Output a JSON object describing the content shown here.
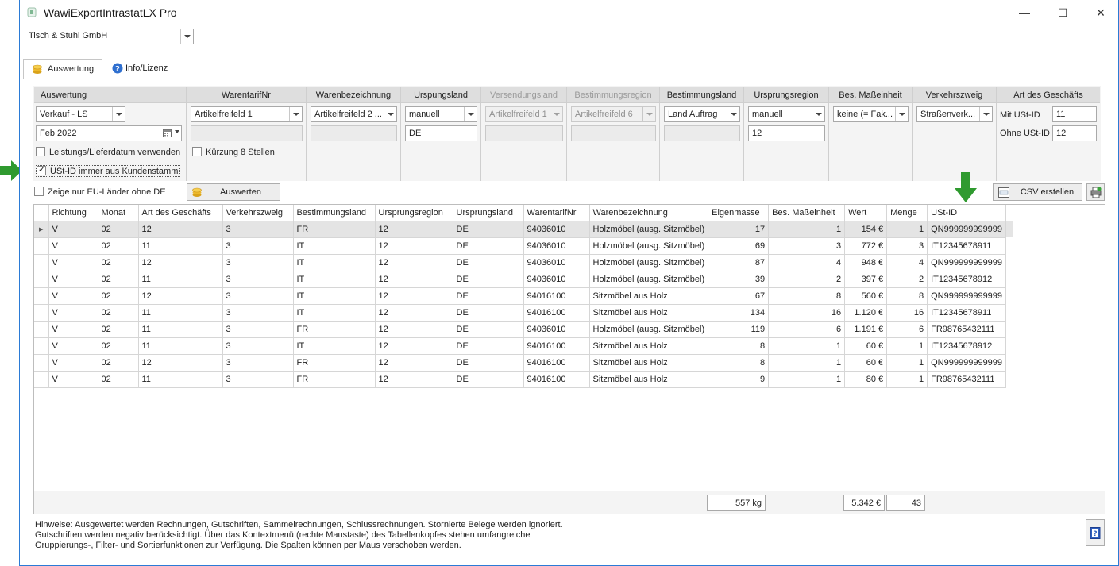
{
  "window": {
    "title": "WawiExportIntrastatLX Pro",
    "minimize": "—",
    "maximize": "☐",
    "close": "✕"
  },
  "company": {
    "value": "Tisch & Stuhl GmbH"
  },
  "tabs": [
    {
      "label": "Auswertung",
      "active": true,
      "icon": "coins-icon"
    },
    {
      "label": "Info/Lizenz",
      "active": false,
      "icon": "info-icon"
    }
  ],
  "filters": {
    "auswertung": {
      "header": "Auswertung",
      "type_value": "Verkauf - LS",
      "date_value": "Feb 2022",
      "chk_leistungsdatum": "Leistungs/Lieferdatum verwenden",
      "chk_ustid": "USt-ID immer aus Kundenstamm",
      "chk_ustid_checked": true
    },
    "warentarifnr": {
      "header": "WarentarifNr",
      "value": "Artikelfreifeld 1",
      "chk_kuerzung": "Kürzung 8 Stellen"
    },
    "warenbezeichnung": {
      "header": "Warenbezeichnung",
      "value": "Artikelfreifeld 2 ..."
    },
    "ursprungsland": {
      "header": "Urspungsland",
      "value": "manuell",
      "text": "DE"
    },
    "versendungsland": {
      "header": "Versendungsland",
      "value": "Artikelfreifeld 1"
    },
    "bestimmungsregion": {
      "header": "Bestimmungsregion",
      "value": "Artikelfreifeld 6"
    },
    "bestimmungsland": {
      "header": "Bestimmungsland",
      "value": "Land Auftrag"
    },
    "ursprungsregion": {
      "header": "Ursprungsregion",
      "value": "manuell",
      "text": "12"
    },
    "bes_masseinheit": {
      "header": "Bes. Maßeinheit",
      "value": "keine (= Fak..."
    },
    "verkehrszweig": {
      "header": "Verkehrszweig",
      "value": "Straßenverk..."
    },
    "art_geschaefts": {
      "header": "Art des Geschäfts",
      "mit_label": "Mit USt-ID",
      "mit_value": "11",
      "ohne_label": "Ohne USt-ID",
      "ohne_value": "12"
    }
  },
  "actions": {
    "chk_eu_only": "Zeige nur EU-Länder ohne DE",
    "auswerten": "Auswerten",
    "csv": "CSV erstellen"
  },
  "table": {
    "columns": [
      "Richtung",
      "Monat",
      "Art des Geschäfts",
      "Verkehrszweig",
      "Bestimmungsland",
      "Ursprungsregion",
      "Ursprungsland",
      "WarentarifNr",
      "Warenbezeichnung",
      "Eigenmasse",
      "Bes. Maßeinheit",
      "Wert",
      "Menge",
      "USt-ID"
    ],
    "rows": [
      [
        "V",
        "02",
        "12",
        "3",
        "FR",
        "12",
        "DE",
        "94036010",
        "Holzmöbel (ausg. Sitzmöbel)",
        "17",
        "1",
        "154 €",
        "1",
        "QN999999999999"
      ],
      [
        "V",
        "02",
        "11",
        "3",
        "IT",
        "12",
        "DE",
        "94036010",
        "Holzmöbel (ausg. Sitzmöbel)",
        "69",
        "3",
        "772 €",
        "3",
        "IT12345678911"
      ],
      [
        "V",
        "02",
        "12",
        "3",
        "IT",
        "12",
        "DE",
        "94036010",
        "Holzmöbel (ausg. Sitzmöbel)",
        "87",
        "4",
        "948 €",
        "4",
        "QN999999999999"
      ],
      [
        "V",
        "02",
        "11",
        "3",
        "IT",
        "12",
        "DE",
        "94036010",
        "Holzmöbel (ausg. Sitzmöbel)",
        "39",
        "2",
        "397 €",
        "2",
        "IT12345678912"
      ],
      [
        "V",
        "02",
        "12",
        "3",
        "IT",
        "12",
        "DE",
        "94016100",
        "Sitzmöbel aus Holz",
        "67",
        "8",
        "560 €",
        "8",
        "QN999999999999"
      ],
      [
        "V",
        "02",
        "11",
        "3",
        "IT",
        "12",
        "DE",
        "94016100",
        "Sitzmöbel aus Holz",
        "134",
        "16",
        "1.120 €",
        "16",
        "IT12345678911"
      ],
      [
        "V",
        "02",
        "11",
        "3",
        "FR",
        "12",
        "DE",
        "94036010",
        "Holzmöbel (ausg. Sitzmöbel)",
        "119",
        "6",
        "1.191 €",
        "6",
        "FR98765432111"
      ],
      [
        "V",
        "02",
        "11",
        "3",
        "IT",
        "12",
        "DE",
        "94016100",
        "Sitzmöbel aus Holz",
        "8",
        "1",
        "60 €",
        "1",
        "IT12345678912"
      ],
      [
        "V",
        "02",
        "12",
        "3",
        "FR",
        "12",
        "DE",
        "94016100",
        "Sitzmöbel aus Holz",
        "8",
        "1",
        "60 €",
        "1",
        "QN999999999999"
      ],
      [
        "V",
        "02",
        "11",
        "3",
        "FR",
        "12",
        "DE",
        "94016100",
        "Sitzmöbel aus Holz",
        "9",
        "1",
        "80 €",
        "1",
        "FR98765432111"
      ]
    ]
  },
  "totals": {
    "eigenmasse": "557 kg",
    "wert": "5.342 €",
    "menge": "43"
  },
  "hint": {
    "line1": "Hinweise: Ausgewertet werden Rechnungen, Gutschriften, Sammelrechnungen, Schlussrechnungen. Stornierte Belege werden ignoriert.",
    "line2": "Gutschriften werden negativ berücksichtigt. Über das Kontextmenü (rechte Maustaste) des Tabellenkopfes stehen umfangreiche",
    "line3": "Gruppierungs-, Filter- und Sortierfunktionen zur Verfügung. Die Spalten können per Maus verschoben werden."
  },
  "colors": {
    "accent_arrow": "#2f9a2f",
    "window_border": "#2b7bd6",
    "header_bg": "#dedede"
  }
}
